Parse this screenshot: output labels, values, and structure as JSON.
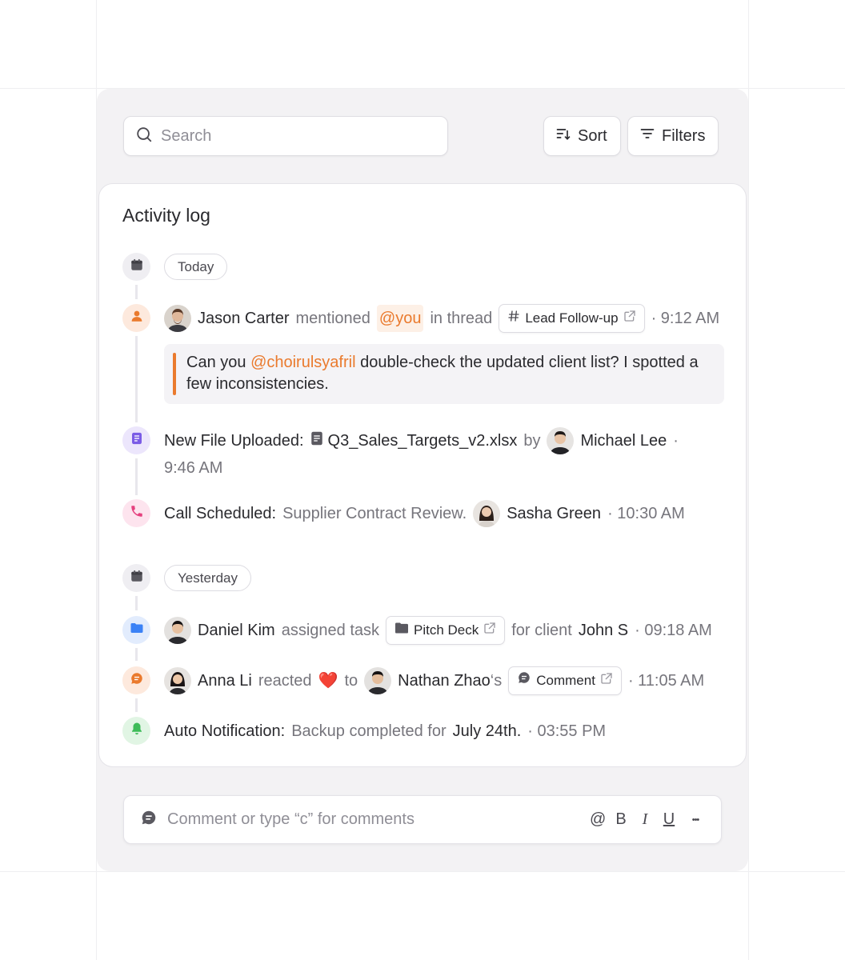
{
  "toolbar": {
    "search_placeholder": "Search",
    "sort_label": "Sort",
    "filters_label": "Filters"
  },
  "card": {
    "title": "Activity log"
  },
  "groups": {
    "today": "Today",
    "yesterday": "Yesterday"
  },
  "entries": {
    "mention": {
      "user": "Jason Carter",
      "action": "mentioned",
      "mention": "@you",
      "in_thread": "in thread",
      "thread": "Lead Follow-up",
      "time": "· 9:12 AM",
      "quote_prefix": "Can you",
      "quote_mention": "@choirulsyafril",
      "quote_rest": "double-check the updated client list? I spotted a few inconsistencies."
    },
    "upload": {
      "label": "New File Uploaded:",
      "file": "Q3_Sales_Targets_v2.xlsx",
      "by": "by",
      "user": "Michael Lee",
      "dot": "·",
      "time": "9:46 AM"
    },
    "call": {
      "label": "Call Scheduled:",
      "subject": "Supplier Contract Review.",
      "user": "Sasha Green",
      "time": "· 10:30 AM"
    },
    "assign": {
      "user": "Daniel Kim",
      "action": "assigned task",
      "task": "Pitch Deck",
      "for_client": "for client",
      "client": "John S",
      "time": "· 09:18 AM"
    },
    "reaction": {
      "user": "Anna Li",
      "action": "reacted",
      "emoji": "❤️",
      "to": "to",
      "target": "Nathan Zhao",
      "possessive": "‘s",
      "item": "Comment",
      "time": "· 11:05 AM"
    },
    "auto": {
      "label": "Auto Notification:",
      "text": "Backup completed for",
      "date": "July 24th.",
      "time": "· 03:55 PM"
    }
  },
  "composer": {
    "placeholder": "Comment or type “c” for comments",
    "at": "@",
    "bold": "B",
    "italic": "I",
    "underline": "U",
    "more": "•••"
  },
  "colors": {
    "accent_orange": "#ea7a2d",
    "purple": "#7b5ce6",
    "pink": "#e5407e",
    "blue": "#3b82f6",
    "green": "#3dbb58"
  }
}
